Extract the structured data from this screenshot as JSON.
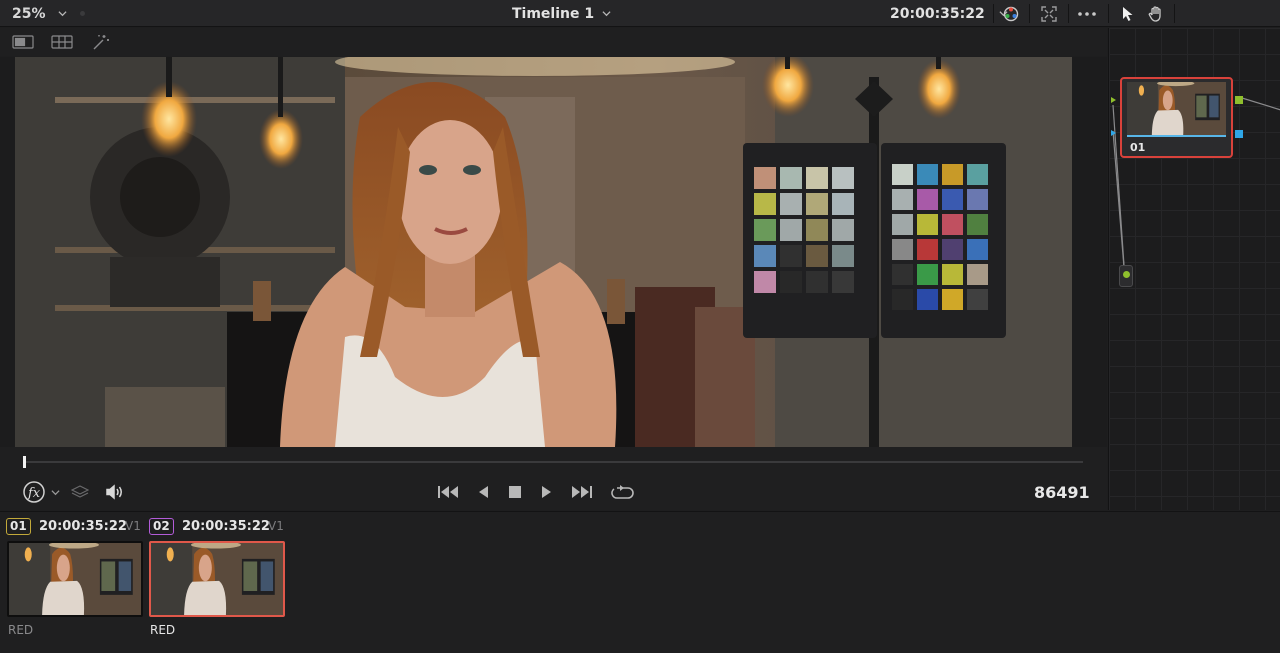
{
  "topbar": {
    "zoom": "25%",
    "timeline_name": "Timeline 1",
    "timecode": "20:00:35:22",
    "icons": [
      "chevron-down-icon",
      "color-wheel-icon",
      "fullscreen-icon",
      "more-options-icon",
      "pointer-icon",
      "hand-icon"
    ]
  },
  "viewer_toolbar": {
    "icons": [
      "single-viewer-icon",
      "gallery-view-icon",
      "magic-wand-icon"
    ]
  },
  "viewer": {
    "colors": {
      "background": "#4a3a2c",
      "accent_warm": "#f5c36a"
    }
  },
  "transport": {
    "frame_count": "86491",
    "icons": [
      "fx-icon",
      "layers-icon",
      "speaker-icon",
      "skip-to-start-icon",
      "play-reverse-icon",
      "stop-icon",
      "play-icon",
      "skip-to-end-icon",
      "loop-icon"
    ]
  },
  "node_editor": {
    "node_label": "01",
    "colors": {
      "selected_border": "#d9423b",
      "input_port": "#8fbf2d",
      "output_port": "#2fa7e8"
    }
  },
  "clips": [
    {
      "number": "01",
      "timecode": "20:00:35:22",
      "track": "V1",
      "codec": "RED",
      "selected": false,
      "num_border": "#c2a93a"
    },
    {
      "number": "02",
      "timecode": "20:00:35:22",
      "track": "V1",
      "codec": "RED",
      "selected": true,
      "num_border": "#b35cd9"
    }
  ]
}
